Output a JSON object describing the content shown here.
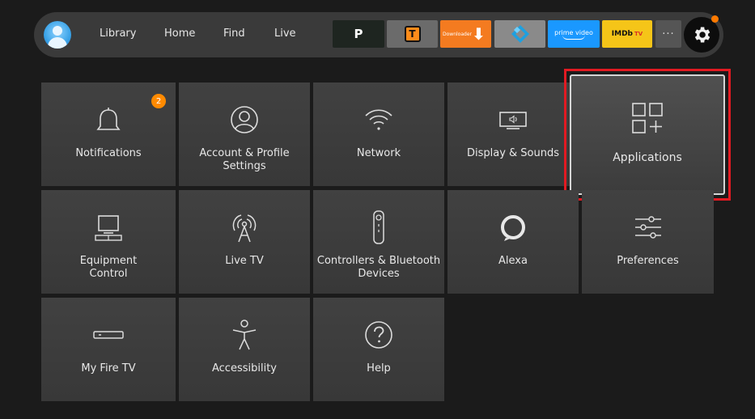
{
  "nav": {
    "items": [
      "Library",
      "Home",
      "Find",
      "Live"
    ]
  },
  "apps": {
    "p_label": "P",
    "t_label": "T",
    "downloader_label": "Downloader",
    "prime_label": "prime video",
    "imdb_label": "IMDb",
    "imdb_tv": "TV",
    "more_label": "···"
  },
  "tiles": [
    {
      "label": "Notifications",
      "badge": "2"
    },
    {
      "label": "Account & Profile Settings"
    },
    {
      "label": "Network"
    },
    {
      "label": "Display & Sounds"
    },
    {
      "label": "Applications"
    },
    {
      "label": "Equipment Control"
    },
    {
      "label": "Live TV"
    },
    {
      "label": "Controllers & Bluetooth Devices"
    },
    {
      "label": "Alexa"
    },
    {
      "label": "Preferences"
    },
    {
      "label": "My Fire TV"
    },
    {
      "label": "Accessibility"
    },
    {
      "label": "Help"
    }
  ],
  "colors": {
    "focus": "#e21a22",
    "badge": "#ff8a00",
    "accent": "#ff7a00"
  }
}
